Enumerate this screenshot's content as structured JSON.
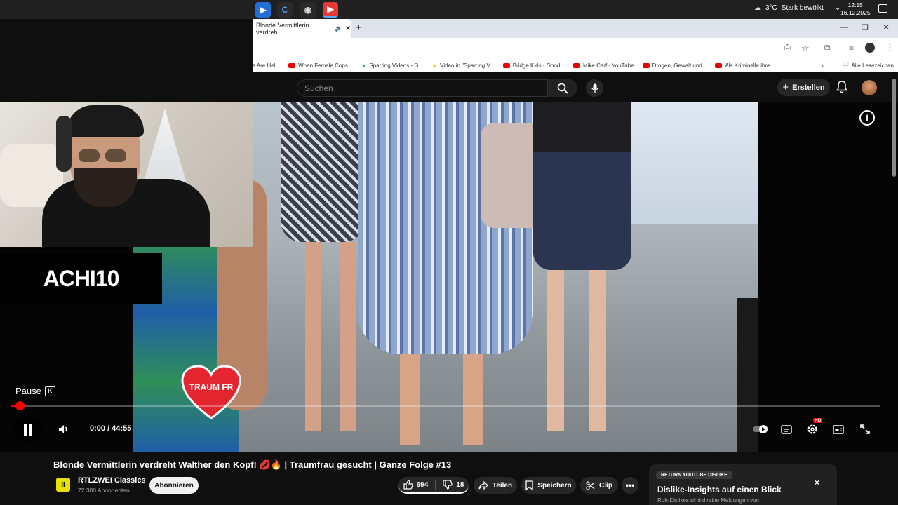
{
  "taskbar": {
    "weather": "3°C",
    "weather_desc": "Stark bewölkt",
    "time": "12:15",
    "date": "16.12.2025"
  },
  "browser": {
    "tab_title": "Blonde Vermittlerin verdreh",
    "bookmarks": [
      "s Are Hel...",
      "When Female Cops...",
      "Sparring Videos - G...",
      "Video in \"Sparring V...",
      "Bridge Kids - Good...",
      "Mike Carf - YouTube",
      "Drogen, Gewalt und...",
      "Als Kriminelle ihre..."
    ],
    "all_bookmarks": "Alle Lesezeichen"
  },
  "youtube": {
    "search_placeholder": "Suchen",
    "create_label": "Erstellen"
  },
  "stream": {
    "logo_text": "ACHI10",
    "heart_text": "TRAUM FR"
  },
  "player": {
    "pause_tooltip": "Pause",
    "pause_key": "K",
    "time": "0:00 / 44:55",
    "progress_fraction": 0.01,
    "hd_badge": "HD"
  },
  "video": {
    "title": "Blonde Vermittlerin verdreht Walther den Kopf! 💋🔥 | Traumfrau gesucht | Ganze Folge #13",
    "channel": "RTLZWEI Classics",
    "subscribers": "72.300 Abonnenten",
    "subscribe_label": "Abonnieren",
    "likes": "694",
    "dislikes": "18",
    "share_label": "Teilen",
    "save_label": "Speichern",
    "clip_label": "Clip"
  },
  "ryd": {
    "badge": "RETURN YOUTUBE DISLIKE",
    "heading": "Dislike-Insights auf einen Blick",
    "subtext": "Roh-Dislikes sind direkte Meldungen von"
  }
}
